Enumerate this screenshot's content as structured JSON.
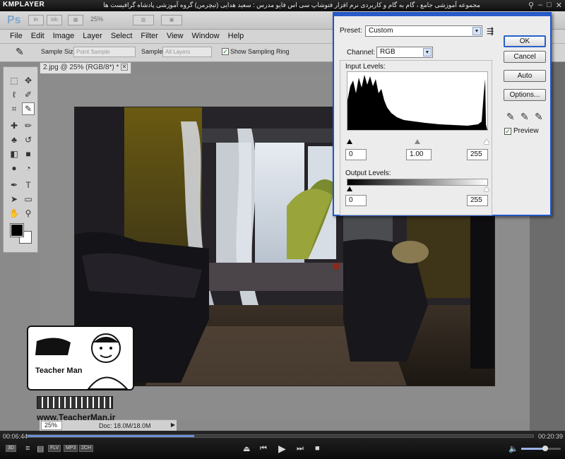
{
  "player": {
    "logo": "KMPLAYER",
    "caption": "مجموعه آموزشی جامع ، گام به گام و کاربردی نرم افزار فتوشاپ سی اس فایو  مدرس : سعید هدایی (تیچرمن) گروه آموزشی پادشاه گرافیست ها",
    "time_elapsed": "00:06:44",
    "time_total": "00:20:39",
    "progress": 0.33,
    "volume": 0.6,
    "tags": [
      "FLV",
      "MP3",
      "2CH"
    ],
    "mode_label": "3D"
  },
  "photoshop": {
    "app_logo": "Ps",
    "zoom_select": "25%",
    "menu": [
      "File",
      "Edit",
      "Image",
      "Layer",
      "Select",
      "Filter",
      "View",
      "Window",
      "Help"
    ],
    "options": {
      "sample_size_label": "Sample Size:",
      "sample_size_value": "Point Sample",
      "sample_label": "Sample:",
      "sample_value": "All Layers",
      "show_ring_label": "Show Sampling Ring",
      "show_ring_checked": true
    },
    "document_tab": "2.jpg @ 25% (RGB/8*) *",
    "status": {
      "zoom": "25%",
      "doc_info": "Doc: 18.0M/18.0M"
    }
  },
  "levels": {
    "preset_label": "Preset:",
    "preset_value": "Custom",
    "channel_label": "Channel:",
    "channel_value": "RGB",
    "input_levels_label": "Input Levels:",
    "input_black": "0",
    "input_gamma": "1.00",
    "input_white": "255",
    "output_levels_label": "Output Levels:",
    "output_black": "0",
    "output_white": "255",
    "buttons": {
      "ok": "OK",
      "cancel": "Cancel",
      "auto": "Auto",
      "options": "Options..."
    },
    "preview_label": "Preview",
    "preview_checked": true
  },
  "watermark": {
    "brand": "Teacher Man",
    "url": "www.TeacherMan.ir"
  }
}
